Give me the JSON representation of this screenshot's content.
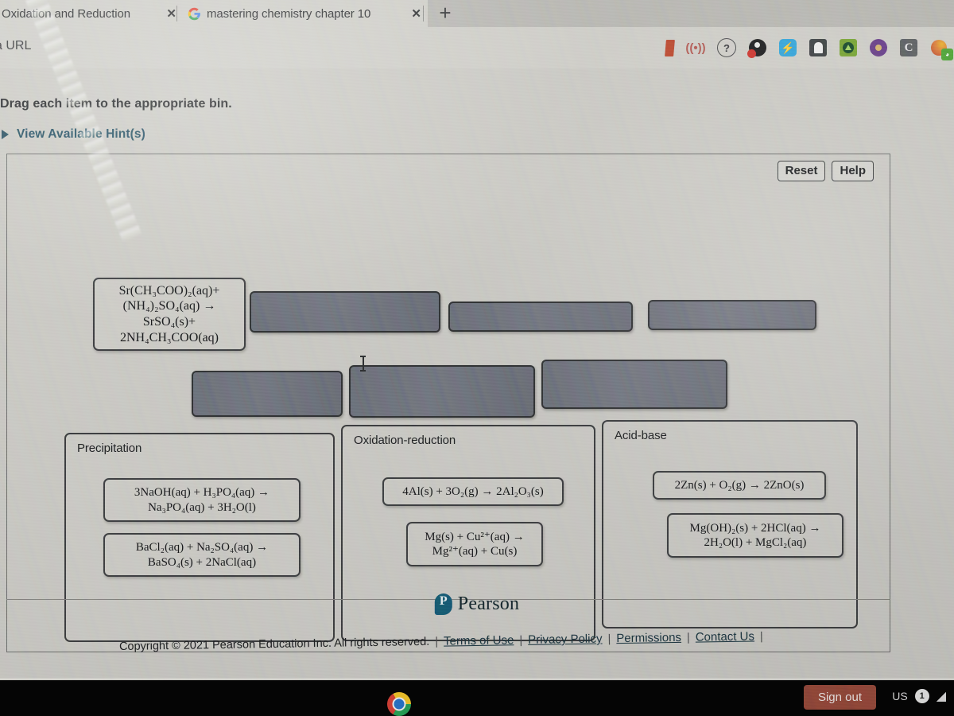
{
  "browser": {
    "tabs": [
      {
        "title": "Oxidation and Reduction",
        "close": "✕",
        "favicon": "none"
      },
      {
        "title": "mastering chemistry chapter 10",
        "close": "✕",
        "favicon": "google-g"
      }
    ],
    "new_tab": "+",
    "url_text": "a URL",
    "extension_icons": [
      "bookmark-icon",
      "rss-icon",
      "help-circle-icon",
      "extension-icon",
      "lightning-icon",
      "note-icon",
      "drive-icon",
      "profile-icon",
      "c-letter-icon",
      "grammarly-icon"
    ]
  },
  "exercise": {
    "prompt": "Drag each item to the appropriate bin.",
    "hints_label": "View Available Hint(s)",
    "reset_label": "Reset",
    "help_label": "Help"
  },
  "source_tile": {
    "equation": "Sr(CH₃COO)₂(aq)+\n(NH₄)₂SO₄(aq) →\nSrSO₄(s)+\n2NH₄CH₃COO(aq)"
  },
  "blank_slots": [
    {
      "id": "slot-1",
      "label": ""
    },
    {
      "id": "slot-2",
      "label": ""
    },
    {
      "id": "slot-3",
      "label": ""
    },
    {
      "id": "slot-4",
      "label": ""
    },
    {
      "id": "slot-5",
      "label": ""
    },
    {
      "id": "slot-6",
      "label": ""
    }
  ],
  "bins": [
    {
      "name": "Precipitation",
      "items": [
        "3NaOH(aq) + H₃PO₄(aq) →\nNa₃PO₄(aq) + 3H₂O(l)",
        "BaCl₂(aq) + Na₂SO₄(aq) →\nBaSO₄(s) + 2NaCl(aq)"
      ]
    },
    {
      "name": "Oxidation-reduction",
      "items": [
        "4Al(s) + 3O₂(g) → 2Al₂O₃(s)",
        "Mg(s) + Cu²⁺(aq) →\nMg²⁺(aq) + Cu(s)"
      ]
    },
    {
      "name": "Acid-base",
      "items": [
        "2Zn(s) + O₂(g) → 2ZnO(s)",
        "Mg(OH)₂(s) + 2HCl(aq) →\n2H₂O(l) + MgCl₂(aq)"
      ]
    }
  ],
  "footer": {
    "brand": "Pearson",
    "copyright": "Copyright © 2021 Pearson Education Inc. All rights reserved.",
    "links": [
      "Terms of Use",
      "Privacy Policy",
      "Permissions",
      "Contact Us"
    ],
    "separator": "|"
  },
  "taskbar": {
    "sign_out": "Sign out",
    "locale": "US",
    "badge_count": "1",
    "wifi": "◢"
  },
  "colors": {
    "page_bg": "#cbcac4",
    "slot_fill": "#6f737e",
    "accent_link": "#15495e",
    "signout_bg": "#9c4635",
    "pearson_blue": "#0d5e7a"
  }
}
